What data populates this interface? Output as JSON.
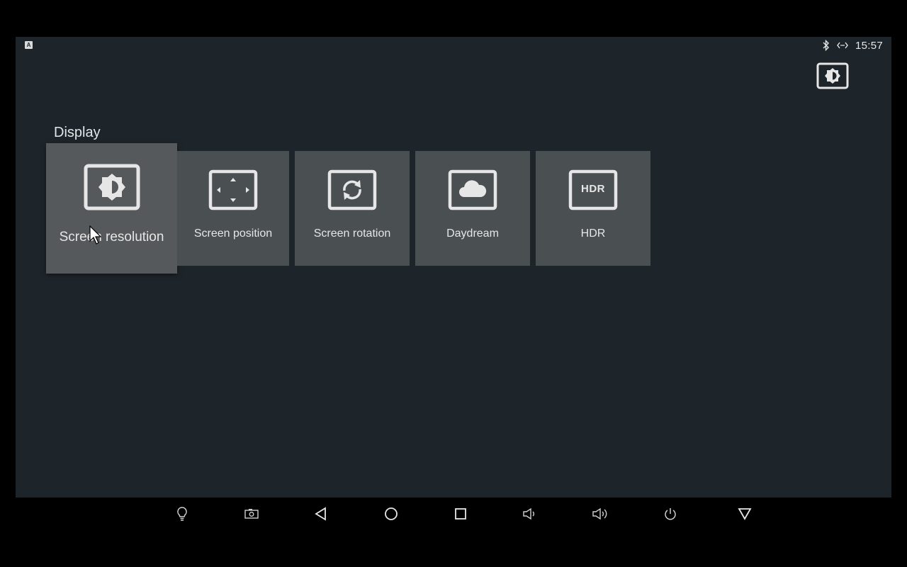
{
  "status_bar": {
    "notification_icon": "A",
    "icons": [
      "bluetooth-icon",
      "data-sync-icon"
    ],
    "time": "15:57"
  },
  "corner_icon": "brightness-icon",
  "section_title": "Display",
  "tiles": [
    {
      "label": "Screen resolution",
      "icon": "brightness-icon",
      "focused": true
    },
    {
      "label": "Screen position",
      "icon": "screen-position-icon",
      "focused": false
    },
    {
      "label": "Screen rotation",
      "icon": "screen-rotation-icon",
      "focused": false
    },
    {
      "label": "Daydream",
      "icon": "daydream-cloud-icon",
      "focused": false
    },
    {
      "label": "HDR",
      "icon": "hdr-icon",
      "focused": false,
      "icon_text": "HDR"
    }
  ],
  "nav_bar": {
    "buttons": [
      "lightbulb-icon",
      "screenshot-icon",
      "back-icon",
      "home-icon",
      "recents-icon",
      "volume-down-icon",
      "volume-up-icon",
      "power-icon",
      "hide-navbar-icon"
    ]
  },
  "colors": {
    "background": "#1e252a",
    "tile": "#4a4f52",
    "tile_focused": "#55595c",
    "text": "#e6e6e6",
    "navbar": "#000000"
  }
}
